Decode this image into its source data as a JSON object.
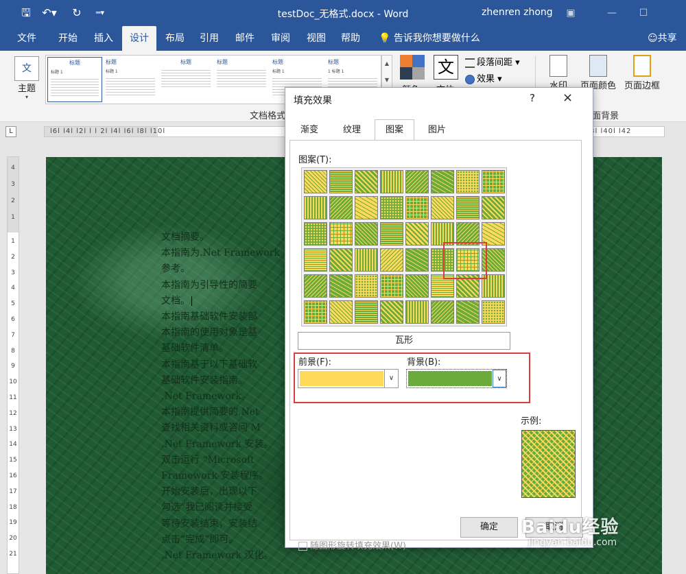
{
  "titlebar": {
    "title": "testDoc_无格式.docx - Word",
    "user": "zhenren zhong",
    "qat": [
      "save-icon",
      "undo-icon",
      "redo-icon",
      "customize-icon"
    ]
  },
  "tabs": [
    {
      "label": "文件"
    },
    {
      "label": "开始"
    },
    {
      "label": "插入"
    },
    {
      "label": "设计"
    },
    {
      "label": "布局"
    },
    {
      "label": "引用"
    },
    {
      "label": "邮件"
    },
    {
      "label": "审阅"
    },
    {
      "label": "视图"
    },
    {
      "label": "帮助"
    }
  ],
  "active_tab": "设计",
  "tellme": "告诉我你想要做什么",
  "share": "共享",
  "ribbon": {
    "theme": "主题",
    "styles": [
      {
        "t1": "标题",
        "t2": "标题 1"
      },
      {
        "t1": "标题",
        "t2": "标题 1"
      },
      {
        "t1": "标题",
        "t2": ""
      },
      {
        "t1": "标题",
        "t2": ""
      },
      {
        "t1": "标题",
        "t2": "标题 1"
      },
      {
        "t1": "标题",
        "t2": "1 标题 1"
      }
    ],
    "colors": "颜色",
    "fonts": "文体",
    "para_spacing": "段落间距",
    "effects": "效果",
    "group_format": "文档格式",
    "watermark": "水印",
    "page_color": "页面颜色",
    "page_border": "页面边框",
    "group_bg": "页面背景"
  },
  "ruler": {
    "corner": "L",
    "h_left": "l6l  l4l  l2l  l  l  2l  l4l  l6l  l8l  l10l",
    "h_right": "l38l  l40l  l42",
    "v_top": [
      "4",
      "3",
      "2",
      "1"
    ],
    "v_nums": [
      "1",
      "2",
      "3",
      "4",
      "5",
      "6",
      "7",
      "8",
      "9",
      "10",
      "11",
      "12",
      "13",
      "14",
      "15",
      "16",
      "17",
      "18",
      "19",
      "20",
      "21"
    ]
  },
  "document": {
    "lines": [
      "文档摘要。",
      "本指南为.Net Framework",
      "参考。",
      "本指南为引导性的简要",
      "文档。",
      "本指南基础软件安装部",
      "本指南的使用对象是基",
      "基础软件清单。",
      "本指南基于以下基础软",
      "基础软件安装指南。",
      ".Net Framework。",
      "本指南提供简要的.Net",
      "查找相关资料或咨问 M",
      ".Net Framework 安装。",
      "双击运行 “Microsoft",
      "Framework 安装程序。",
      "开始安装后，出现以下",
      "勾选“我已阅读并接受",
      "等待安装结束，安装结",
      "点击“完成”即可。",
      ".Net Framework 汉化。"
    ]
  },
  "dialog": {
    "title": "填充效果",
    "help": "?",
    "close": "×",
    "tabs": [
      "渐变",
      "纹理",
      "图案",
      "图片"
    ],
    "active_tab": "图案",
    "pattern_label": "图案(T):",
    "selected_pattern": "瓦形",
    "foreground_label": "前景(F):",
    "background_label": "背景(B):",
    "foreground_color": "#ffd95a",
    "background_color": "#6aab3c",
    "sample_label": "示例:",
    "rotate_label": "随图形旋转填充效果(W)",
    "ok": "确定",
    "cancel": "取消"
  },
  "colors": {
    "title_bar": "#2b579a",
    "accent_red": "#e03a3a",
    "pattern_fg": "#ffd95a",
    "pattern_bg": "#6aab3c"
  },
  "watermark": {
    "logo": "Baidu经验",
    "url": "jingyan.baidu.com"
  }
}
